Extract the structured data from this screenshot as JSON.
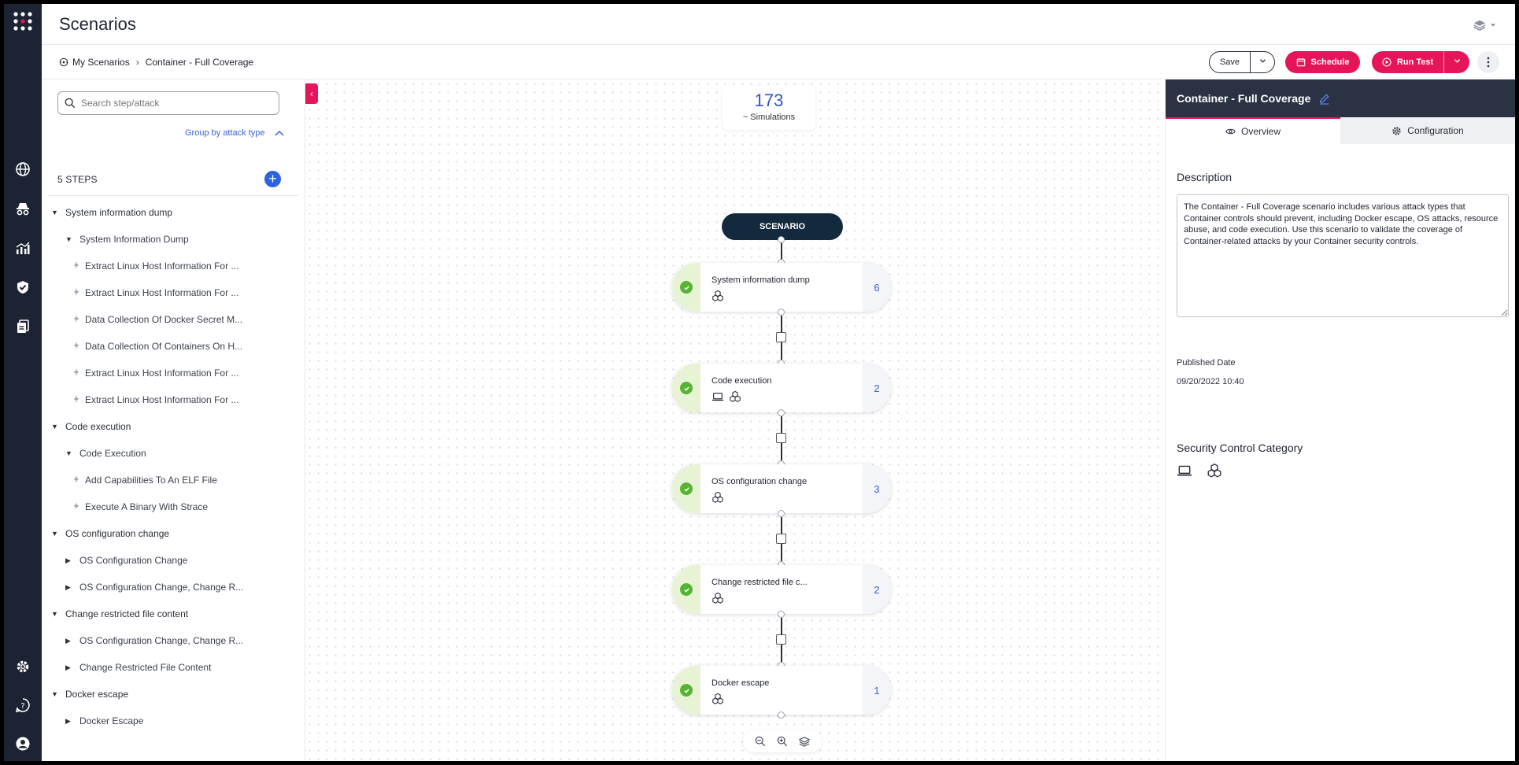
{
  "app": {
    "title": "Scenarios"
  },
  "breadcrumb": {
    "root": "My Scenarios",
    "current": "Container - Full Coverage"
  },
  "toolbar": {
    "save_label": "Save",
    "schedule_label": "Schedule",
    "run_label": "Run Test"
  },
  "colors": {
    "accent": "#e6155a",
    "rail": "#1c2333",
    "link": "#3a63d8",
    "success": "#55b432",
    "panel_head": "#2b3244"
  },
  "rail": {
    "top_icon": "apps-grid-icon",
    "items": [
      "globe-icon",
      "incognito-icon",
      "analytics-icon",
      "shield-check-icon",
      "documents-icon"
    ],
    "bottom": [
      "settings-icon",
      "help-icon",
      "user-icon"
    ]
  },
  "steps_panel": {
    "search_placeholder": "Search step/attack",
    "group_toggle": "Group by attack type",
    "steps_count": "5 STEPS",
    "tree": [
      {
        "level": 0,
        "label": "System information dump",
        "expanded": true
      },
      {
        "level": 1,
        "label": "System Information Dump",
        "expanded": true
      },
      {
        "level": 2,
        "label": "Extract Linux Host Information For ..."
      },
      {
        "level": 2,
        "label": "Extract Linux Host Information For ..."
      },
      {
        "level": 2,
        "label": "Data Collection Of Docker Secret M..."
      },
      {
        "level": 2,
        "label": "Data Collection Of Containers On H..."
      },
      {
        "level": 2,
        "label": "Extract Linux Host Information For ..."
      },
      {
        "level": 2,
        "label": "Extract Linux Host Information For ..."
      },
      {
        "level": 0,
        "label": "Code execution",
        "expanded": true
      },
      {
        "level": 1,
        "label": "Code Execution",
        "expanded": true
      },
      {
        "level": 2,
        "label": "Add Capabilities To An ELF File"
      },
      {
        "level": 2,
        "label": "Execute A Binary With Strace"
      },
      {
        "level": 0,
        "label": "OS configuration change",
        "expanded": true
      },
      {
        "level": 1,
        "label": "OS Configuration Change",
        "expanded": false
      },
      {
        "level": 1,
        "label": "OS Configuration Change, Change R...",
        "expanded": false
      },
      {
        "level": 0,
        "label": "Change restricted file content",
        "expanded": true
      },
      {
        "level": 1,
        "label": "OS Configuration Change, Change R...",
        "expanded": false
      },
      {
        "level": 1,
        "label": "Change Restricted File Content",
        "expanded": false
      },
      {
        "level": 0,
        "label": "Docker escape",
        "expanded": true
      },
      {
        "level": 1,
        "label": "Docker Escape",
        "expanded": false
      }
    ]
  },
  "canvas": {
    "simulations_count": "173",
    "simulations_label": "~ Simulations",
    "root_label": "SCENARIO",
    "nodes": [
      {
        "name": "System information dump",
        "count": "6",
        "icons": [
          "container-icon"
        ]
      },
      {
        "name": "Code execution",
        "count": "2",
        "icons": [
          "laptop-icon",
          "container-icon"
        ]
      },
      {
        "name": "OS configuration change",
        "count": "3",
        "icons": [
          "container-icon"
        ]
      },
      {
        "name": "Change restricted file c...",
        "count": "2",
        "icons": [
          "container-icon"
        ]
      },
      {
        "name": "Docker escape",
        "count": "1",
        "icons": [
          "container-icon"
        ]
      }
    ]
  },
  "details": {
    "title": "Container - Full Coverage",
    "tabs": [
      "Overview",
      "Configuration"
    ],
    "description_label": "Description",
    "description": "The Container - Full Coverage scenario includes various attack types that Container controls should prevent, including Docker escape, OS attacks, resource abuse, and code execution. Use this scenario to validate the coverage of Container-related attacks by your Container security controls.",
    "published_label": "Published Date",
    "published_value": "09/20/2022 10:40",
    "security_label": "Security Control Category",
    "security_icons": [
      "laptop-icon",
      "container-icon"
    ]
  }
}
